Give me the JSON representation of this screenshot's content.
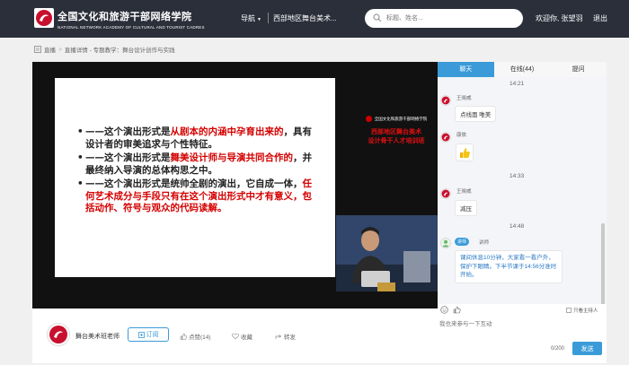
{
  "header": {
    "logo_cn": "全国文化和旅游干部网络学院",
    "logo_en": "NATIONAL NETWORK ACADEMY OF CULTURAL AND TOURIST CADRES",
    "nav_label": "导航",
    "region_label": "西部地区舞台美术...",
    "search_placeholder": "标题、姓名...",
    "welcome": "欢迎你, 张望羽",
    "logout": "退出"
  },
  "breadcrumb": {
    "items": [
      "直播",
      "直播详情 - 专题教学：舞台设计创作与实践"
    ]
  },
  "slide": {
    "bullets": [
      {
        "parts": [
          {
            "t": "——这个演出形式是",
            "red": false
          },
          {
            "t": "从剧本的内涵中孕育出来的",
            "red": true
          },
          {
            "t": "，具有设计者的审美追求与个性特征。",
            "red": false
          }
        ]
      },
      {
        "parts": [
          {
            "t": "——这个演出形式是",
            "red": false
          },
          {
            "t": "舞美设计师与导演共同合作的",
            "red": true
          },
          {
            "t": "，并最终纳入导演的总体构思之中。",
            "red": false
          }
        ]
      },
      {
        "parts": [
          {
            "t": "——这个演出形式是统帅全剧的演出，它自成一体，",
            "red": false
          },
          {
            "t": "任何艺术成分与手段只有在这个演出形式中才有意义，包括动作、符号与观众的代码读解。",
            "red": true
          }
        ]
      }
    ]
  },
  "player_brand": {
    "academy_small": "全国文化和旅游干部网络学院",
    "red_line1": "西部地区舞台美术",
    "red_line2": "设计骨干人才培训班"
  },
  "info_bar": {
    "teacher_name": "舞台美术班老师",
    "subscribe": "订阅",
    "like": "点赞(14)",
    "favorite": "收藏",
    "share": "转发"
  },
  "panel": {
    "tabs": [
      "聊天",
      "在线(44)",
      "提问"
    ],
    "active_tab": 0,
    "messages": [
      {
        "time": "14:21"
      },
      {
        "name": "王晓威",
        "text": "点线面 唯美"
      },
      {
        "name": "康旅",
        "type": "thumb"
      },
      {
        "time": "14:33"
      },
      {
        "name": "王晓威",
        "text": "减压"
      },
      {
        "time": "14:48"
      },
      {
        "badge": "讲师",
        "name": "讲师",
        "text": "课间休息10分钟，大家看一看户外，保护下眼睛。下半节课于14:56分准时开始。"
      }
    ],
    "only_host": "只看主持人",
    "input_placeholder": "我也来参与一下互动",
    "counter": "0/200",
    "send": "发送"
  },
  "colors": {
    "header_bg": "#2b2f3a",
    "accent": "#3a9bd8",
    "slide_red": "#d40000"
  }
}
